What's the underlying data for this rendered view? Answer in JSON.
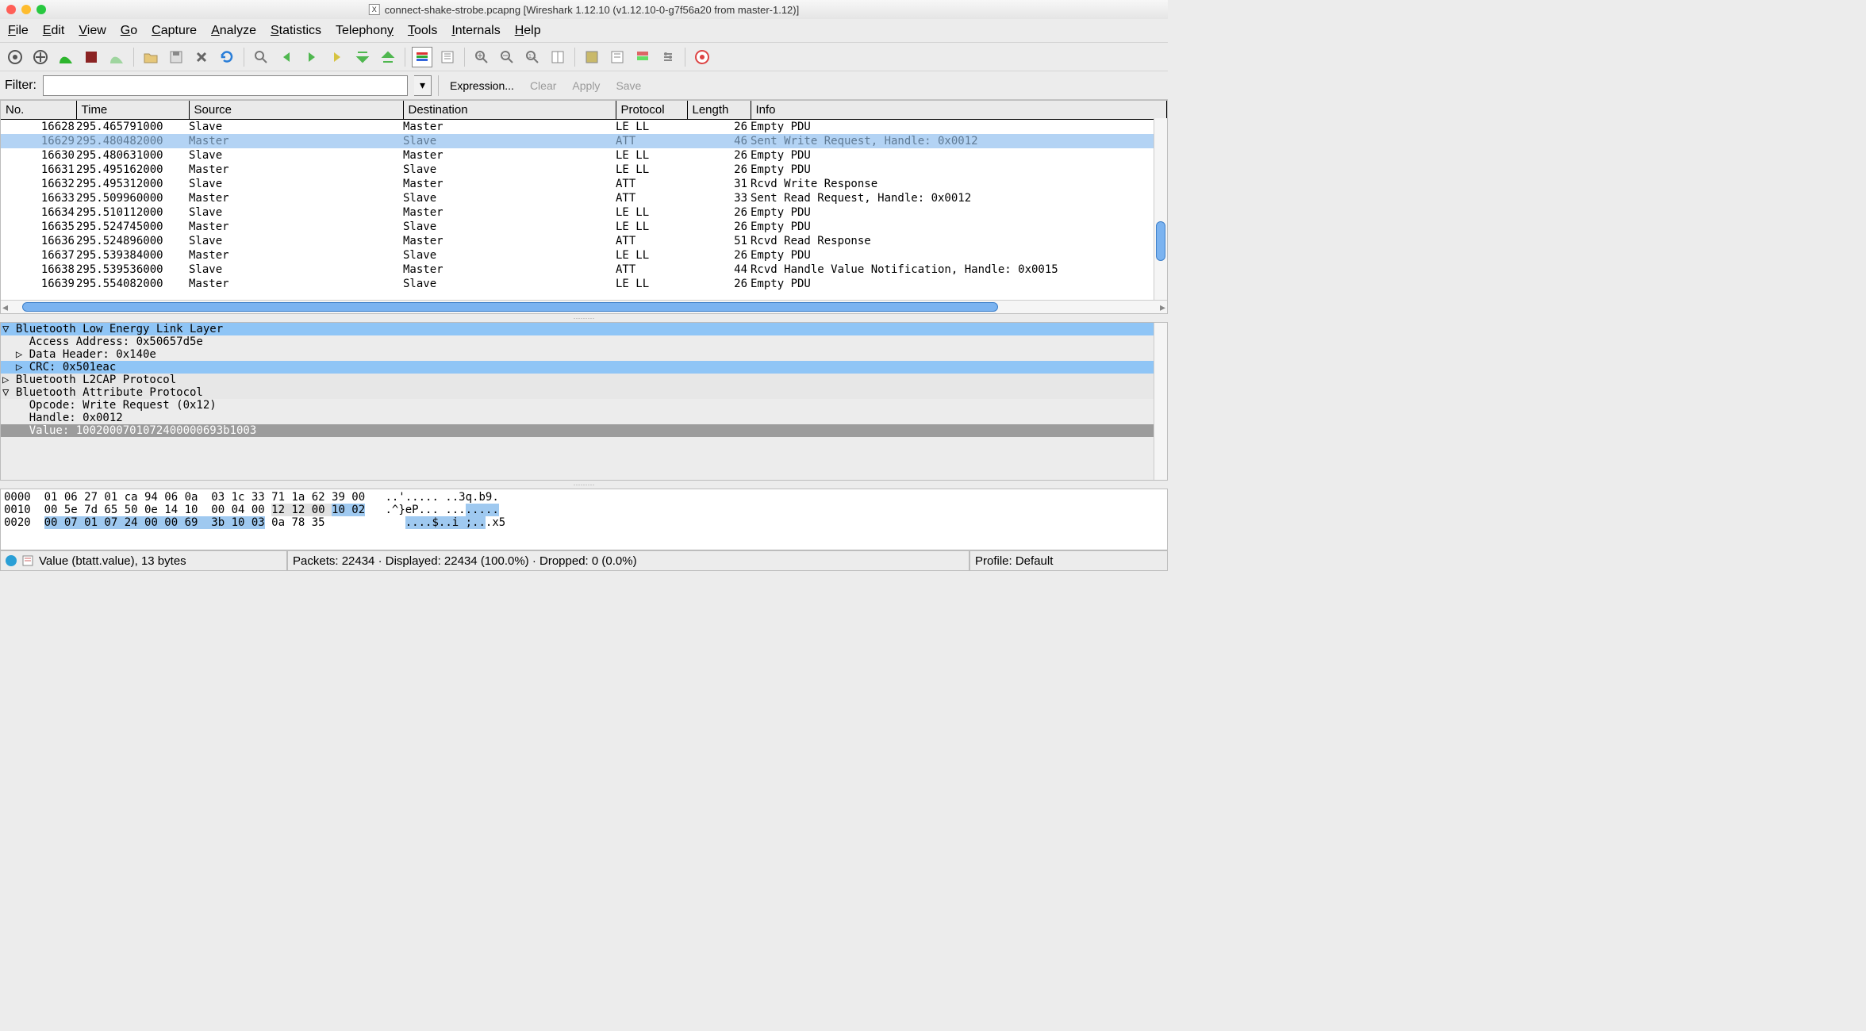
{
  "window": {
    "file_icon": "x",
    "title": "connect-shake-strobe.pcapng   [Wireshark 1.12.10  (v1.12.10-0-g7f56a20 from master-1.12)]"
  },
  "menu": {
    "file": "File",
    "edit": "Edit",
    "view": "View",
    "go": "Go",
    "capture": "Capture",
    "analyze": "Analyze",
    "statistics": "Statistics",
    "telephony": "Telephony",
    "tools": "Tools",
    "internals": "Internals",
    "help": "Help"
  },
  "filter": {
    "label": "Filter:",
    "value": "",
    "expression": "Expression...",
    "clear": "Clear",
    "apply": "Apply",
    "save": "Save"
  },
  "columns": [
    "No.",
    "Time",
    "Source",
    "Destination",
    "Protocol",
    "Length",
    "Info"
  ],
  "packets": [
    {
      "no": "16628",
      "time": "295.465791000",
      "src": "Slave",
      "dst": "Master",
      "proto": "LE LL",
      "len": "26",
      "info": "Empty PDU"
    },
    {
      "no": "16629",
      "time": "295.480482000",
      "src": "Master",
      "dst": "Slave",
      "proto": "ATT",
      "len": "46",
      "info": "Sent Write Request, Handle: 0x0012",
      "selected": true
    },
    {
      "no": "16630",
      "time": "295.480631000",
      "src": "Slave",
      "dst": "Master",
      "proto": "LE LL",
      "len": "26",
      "info": "Empty PDU"
    },
    {
      "no": "16631",
      "time": "295.495162000",
      "src": "Master",
      "dst": "Slave",
      "proto": "LE LL",
      "len": "26",
      "info": "Empty PDU"
    },
    {
      "no": "16632",
      "time": "295.495312000",
      "src": "Slave",
      "dst": "Master",
      "proto": "ATT",
      "len": "31",
      "info": "Rcvd Write Response"
    },
    {
      "no": "16633",
      "time": "295.509960000",
      "src": "Master",
      "dst": "Slave",
      "proto": "ATT",
      "len": "33",
      "info": "Sent Read Request, Handle: 0x0012"
    },
    {
      "no": "16634",
      "time": "295.510112000",
      "src": "Slave",
      "dst": "Master",
      "proto": "LE LL",
      "len": "26",
      "info": "Empty PDU"
    },
    {
      "no": "16635",
      "time": "295.524745000",
      "src": "Master",
      "dst": "Slave",
      "proto": "LE LL",
      "len": "26",
      "info": "Empty PDU"
    },
    {
      "no": "16636",
      "time": "295.524896000",
      "src": "Slave",
      "dst": "Master",
      "proto": "ATT",
      "len": "51",
      "info": "Rcvd Read Response"
    },
    {
      "no": "16637",
      "time": "295.539384000",
      "src": "Master",
      "dst": "Slave",
      "proto": "LE LL",
      "len": "26",
      "info": "Empty PDU"
    },
    {
      "no": "16638",
      "time": "295.539536000",
      "src": "Slave",
      "dst": "Master",
      "proto": "ATT",
      "len": "44",
      "info": "Rcvd Handle Value Notification, Handle: 0x0015"
    },
    {
      "no": "16639",
      "time": "295.554082000",
      "src": "Master",
      "dst": "Slave",
      "proto": "LE LL",
      "len": "26",
      "info": "Empty PDU"
    }
  ],
  "details": {
    "l0": "▽ Bluetooth Low Energy Link Layer",
    "l1": "    Access Address: 0x50657d5e",
    "l2": "  ▷ Data Header: 0x140e",
    "l3": "  ▷ CRC: 0x501eac",
    "l4": "▷ Bluetooth L2CAP Protocol",
    "l5": "▽ Bluetooth Attribute Protocol",
    "l6": "    Opcode: Write Request (0x12)",
    "l7": "    Handle: 0x0012",
    "l8": "    Value: 1002000701072400000693b1003"
  },
  "hex": {
    "l0_off": "0000",
    "l0_a": "  01 06 27 01 ca 94 06 0a  03 1c 33 71 1a 62 39 00   ",
    "l0_asc": "..'..... ..3q.b9.",
    "l1_off": "0010",
    "l1_a": "  00 5e 7d 65 50 0e 14 10  00 04 00 ",
    "l1_b": "12 12 00 ",
    "l1_c": "10 02",
    "l1_asc_a": "   .^}eP... ...",
    "l1_asc_b": ".....",
    "l2_off": "0020",
    "l2_a": "  ",
    "l2_b": "00 07 01 07 24 00 00 69  3b 10 03",
    "l2_c": " 0a 78 35            ",
    "l2_asc_a": "....$..i ;..",
    "l2_asc_b": ".x5"
  },
  "status": {
    "value": "Value (btatt.value), 13 bytes",
    "packets": "Packets: 22434 · Displayed: 22434 (100.0%)  · Dropped: 0 (0.0%)",
    "profile": "Profile: Default"
  }
}
